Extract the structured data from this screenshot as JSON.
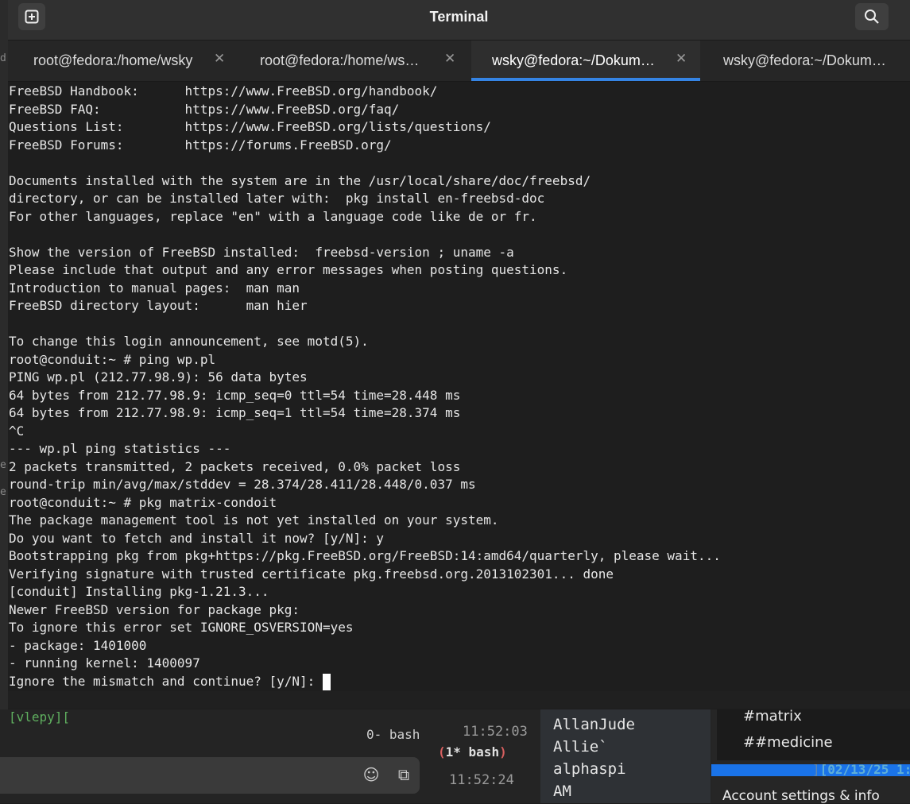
{
  "window": {
    "title": "Terminal"
  },
  "tabs": [
    {
      "label": "root@fedora:/home/wsky",
      "active": false
    },
    {
      "label": "root@fedora:/home/ws…",
      "active": false
    },
    {
      "label": "wsky@fedora:~/Dokum…",
      "active": true
    },
    {
      "label": "wsky@fedora:~/Dokum…",
      "active": false
    }
  ],
  "terminal": {
    "lines": [
      "FreeBSD Handbook:      https://www.FreeBSD.org/handbook/",
      "FreeBSD FAQ:           https://www.FreeBSD.org/faq/",
      "Questions List:        https://www.FreeBSD.org/lists/questions/",
      "FreeBSD Forums:        https://forums.FreeBSD.org/",
      "",
      "Documents installed with the system are in the /usr/local/share/doc/freebsd/",
      "directory, or can be installed later with:  pkg install en-freebsd-doc",
      "For other languages, replace \"en\" with a language code like de or fr.",
      "",
      "Show the version of FreeBSD installed:  freebsd-version ; uname -a",
      "Please include that output and any error messages when posting questions.",
      "Introduction to manual pages:  man man",
      "FreeBSD directory layout:      man hier",
      "",
      "To change this login announcement, see motd(5).",
      "root@conduit:~ # ping wp.pl",
      "PING wp.pl (212.77.98.9): 56 data bytes",
      "64 bytes from 212.77.98.9: icmp_seq=0 ttl=54 time=28.448 ms",
      "64 bytes from 212.77.98.9: icmp_seq=1 ttl=54 time=28.374 ms",
      "^C",
      "--- wp.pl ping statistics ---",
      "2 packets transmitted, 2 packets received, 0.0% packet loss",
      "round-trip min/avg/max/stddev = 28.374/28.411/28.448/0.037 ms",
      "root@conduit:~ # pkg matrix-condoit",
      "The package management tool is not yet installed on your system.",
      "Do you want to fetch and install it now? [y/N]: y",
      "Bootstrapping pkg from pkg+https://pkg.FreeBSD.org/FreeBSD:14:amd64/quarterly, please wait...",
      "Verifying signature with trusted certificate pkg.freebsd.org.2013102301... done",
      "[conduit] Installing pkg-1.21.3...",
      "Newer FreeBSD version for package pkg:",
      "To ignore this error set IGNORE_OSVERSION=yes",
      "- package: 1401000",
      "- running kernel: 1400097",
      "Ignore the mismatch and continue? [y/N]: "
    ]
  },
  "statusbar": {
    "session": "[vlepy][",
    "window0": "0- bash",
    "window1_open": "(",
    "window1": "1* bash",
    "window1_close": ")",
    "right_bracket": "]",
    "datetime": "[02/13/25 1:"
  },
  "background_app": {
    "times": [
      "11:52:03",
      "11:52:24"
    ],
    "users": [
      "AllanJude",
      "Allie`",
      "alphaspi",
      "AM"
    ],
    "channels": [
      "#matrix",
      "##medicine"
    ],
    "account_label": "Account settings & info",
    "left_fragments": [
      "d",
      "e",
      "e"
    ]
  },
  "colors": {
    "accent": "#3584e4",
    "prompt_green": "#5faf5f",
    "active_window_red": "#d75f5f",
    "clock_blue": "#5fafd7"
  }
}
